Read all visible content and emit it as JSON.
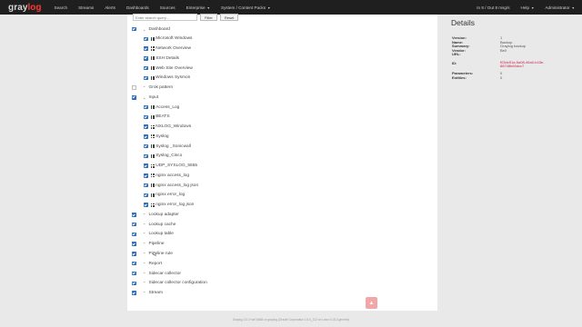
{
  "navbar": {
    "logo_gray": "gray",
    "logo_log": "log",
    "items": [
      "Search",
      "Streams",
      "Alerts",
      "Dashboards",
      "Sources",
      "Enterprise",
      "System / Content Packs"
    ],
    "right_items": [
      "In 8 / Out 8 msg/s",
      "Help",
      "Administrator"
    ]
  },
  "search": {
    "placeholder": "Enter search query...",
    "filter_label": "Filter",
    "reset_label": "Reset"
  },
  "tree": [
    {
      "label": "Dashboard",
      "level": 0,
      "checked": true,
      "expanded": true
    },
    {
      "label": "Microsoft Windows",
      "level": 1,
      "checked": true,
      "icon": true
    },
    {
      "label": "Network Overview",
      "level": 1,
      "checked": true,
      "icon": true
    },
    {
      "label": "SSH Details",
      "level": 1,
      "checked": true,
      "icon": true
    },
    {
      "label": "Web Site Overview",
      "level": 1,
      "checked": true,
      "icon": true
    },
    {
      "label": "Windows Sysmon",
      "level": 1,
      "checked": true,
      "icon": true
    },
    {
      "label": "Grok pattern",
      "level": 0,
      "checked": false,
      "expanded": false
    },
    {
      "label": "Input",
      "level": 0,
      "checked": true,
      "expanded": true
    },
    {
      "label": "Access_Log",
      "level": 1,
      "checked": true,
      "icon": true
    },
    {
      "label": "BEATS",
      "level": 1,
      "checked": true,
      "icon": true
    },
    {
      "label": "NXLOG_Windows",
      "level": 1,
      "checked": true,
      "icon": true
    },
    {
      "label": "Syslog",
      "level": 1,
      "checked": true,
      "icon": true
    },
    {
      "label": "Syslog _Sonicwall",
      "level": 1,
      "checked": true,
      "icon": true
    },
    {
      "label": "Syslog_Cisco",
      "level": 1,
      "checked": true,
      "icon": true
    },
    {
      "label": "UDP_SYSLOG_5555",
      "level": 1,
      "checked": true,
      "icon": true
    },
    {
      "label": "nginx access_log",
      "level": 1,
      "checked": true,
      "icon": true
    },
    {
      "label": "nginx access_log json",
      "level": 1,
      "checked": true,
      "icon": true
    },
    {
      "label": "nginx error_log",
      "level": 1,
      "checked": true,
      "icon": true
    },
    {
      "label": "nginx error_log json",
      "level": 1,
      "checked": true,
      "icon": true
    },
    {
      "label": "Lookup adapter",
      "level": 0,
      "checked": true,
      "expanded": false
    },
    {
      "label": "Lookup cache",
      "level": 0,
      "checked": true,
      "expanded": false
    },
    {
      "label": "Lookup table",
      "level": 0,
      "checked": true,
      "expanded": false
    },
    {
      "label": "Pipeline",
      "level": 0,
      "checked": true,
      "expanded": false
    },
    {
      "label": "Pipeline rule",
      "level": 0,
      "checked": true,
      "expanded": false
    },
    {
      "label": "Report",
      "level": 0,
      "checked": true,
      "expanded": false
    },
    {
      "label": "Sidecar collector",
      "level": 0,
      "checked": true,
      "expanded": false
    },
    {
      "label": "Sidecar collector configuration",
      "level": 0,
      "checked": true,
      "expanded": false
    },
    {
      "label": "Stream",
      "level": 0,
      "checked": true,
      "expanded": false
    }
  ],
  "details": {
    "title": "Details",
    "rows": [
      {
        "key": "Version:",
        "value": "1"
      },
      {
        "key": "Name:",
        "value": "Backup"
      },
      {
        "key": "Summary:",
        "value": "Graylog backup"
      },
      {
        "key": "Vendor:",
        "value": "Bell"
      },
      {
        "key": "URL:",
        "value": ""
      },
      {
        "key": "ID:",
        "value": "f03dc51a-5a08-46a0-b43e-\n88748b60dcc7"
      },
      {
        "key": "Parameters:",
        "value": "0"
      },
      {
        "key": "Entities:",
        "value": "0"
      }
    ]
  },
  "scroll_top_icon": "chevron-up-icon",
  "footer": "Graylog 3.0.1+de74b68 on graylog (Oracle Corporation 1.8.0_212 on Linux 4.15.0-generic)",
  "colors": {
    "navbar": "#1f1f1f",
    "accent": "#ff3633",
    "checkbox": "#2a6ebb",
    "id_value": "#c7254e"
  }
}
